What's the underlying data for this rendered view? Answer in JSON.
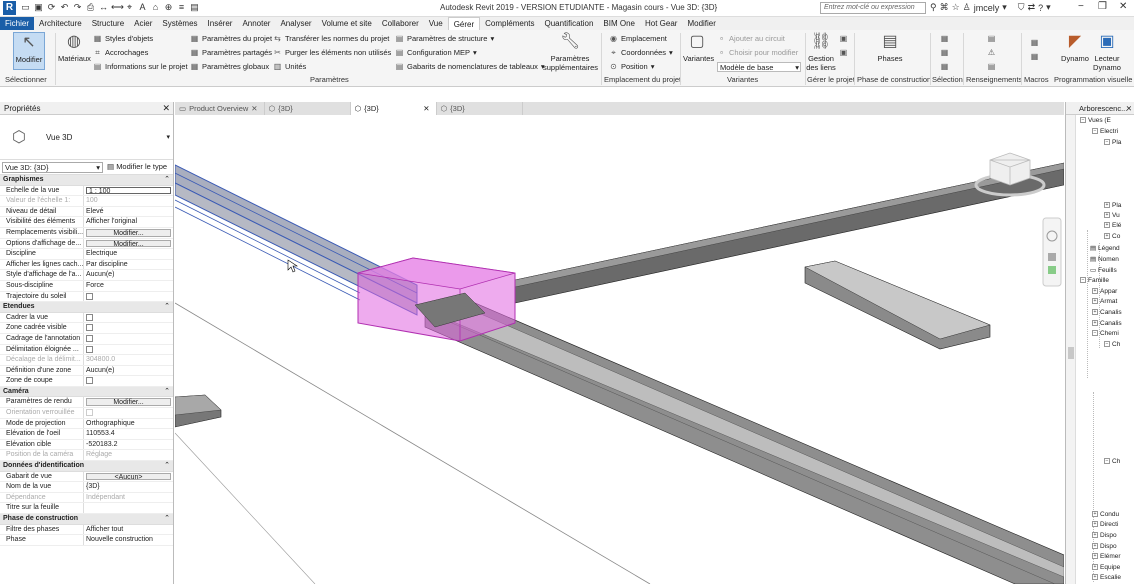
{
  "app": {
    "logo": "R",
    "window_title": "Autodesk Revit 2019 - VERSION ETUDIANTE - Magasin cours - Vue 3D: {3D}",
    "search_placeholder": "Entrez mot-clé ou expression",
    "user": "jmcely"
  },
  "menu": {
    "items": [
      "Fichier",
      "Architecture",
      "Structure",
      "Acier",
      "Systèmes",
      "Insérer",
      "Annoter",
      "Analyser",
      "Volume et site",
      "Collaborer",
      "Vue",
      "Gérer",
      "Compléments",
      "Quantification",
      "BIM One",
      "Hot Gear",
      "Modifier"
    ],
    "active": "Gérer"
  },
  "ribbon": {
    "modifier": "Modifier",
    "materiaux": "Matériaux",
    "styles_objets": "Styles d'objets",
    "accrochages": "Accrochages",
    "infos_projet": "Informations sur le projet",
    "params_projet": "Paramètres du projet",
    "params_partages": "Paramètres partagés",
    "params_globaux": "Paramètres globaux",
    "transferer": "Transférer les normes du projet",
    "purger": "Purger les éléments non utilisés",
    "unites": "Unités",
    "params_structure": "Paramètres de structure",
    "config_mep": "Configuration MEP",
    "gabarits_nomenclatures": "Gabarits de nomenclatures de tableaux",
    "params_supp_1": "Paramètres",
    "params_supp_2": "supplémentaires",
    "emplacement": "Emplacement",
    "coordonnees": "Coordonnées",
    "position": "Position",
    "variantes": "Variantes",
    "ajouter_circuit": "Ajouter au circuit",
    "choisir_modifier": "Choisir pour modifier",
    "modele_base": "Modèle de base",
    "gestion_liens_1": "Gestion",
    "gestion_liens_2": "des liens",
    "phases": "Phases",
    "dynamo": "Dynamo",
    "lecteur_1": "Lecteur",
    "lecteur_2": "Dynamo",
    "panels": {
      "selectionner": "Sélectionner",
      "parametres": "Paramètres",
      "emplacement_projet": "Emplacement du projet",
      "variantes": "Variantes",
      "gerer_projet": "Gérer le projet",
      "phase_construction": "Phase de construction",
      "selection": "Sélection",
      "renseignements": "Renseignements",
      "macros": "Macros",
      "prog_visuelle": "Programmation visuelle"
    }
  },
  "properties": {
    "title": "Propriétés",
    "type_name": "Vue 3D",
    "selector": "Vue 3D: {3D}",
    "edit_type": "Modifier le type",
    "groups": {
      "graphismes": "Graphismes",
      "etendues": "Etendues",
      "camera": "Caméra",
      "donnees": "Données d'identification",
      "phase": "Phase de construction"
    },
    "rows": {
      "echelle_k": "Echelle de la vue",
      "echelle_v": "1 : 100",
      "valeur_k": "Valeur de l'échelle    1:",
      "valeur_v": "100",
      "niveau_k": "Niveau de détail",
      "niveau_v": "Elevé",
      "visib_k": "Visibilité des éléments",
      "visib_v": "Afficher l'original",
      "rempl_k": "Remplacements visibili...",
      "rempl_v": "Modifier...",
      "options_k": "Options d'affichage de...",
      "options_v": "Modifier...",
      "discipline_k": "Discipline",
      "discipline_v": "Electrique",
      "lignes_k": "Afficher les lignes cach...",
      "lignes_v": "Par discipline",
      "style_k": "Style d'affichage de l'a...",
      "style_v": "Aucun(e)",
      "sousdisc_k": "Sous-discipline",
      "sousdisc_v": "Force",
      "trajectoire_k": "Trajectoire du soleil",
      "cadrer_k": "Cadrer la vue",
      "zonecadree_k": "Zone cadrée visible",
      "cadrage_k": "Cadrage de l'annotation",
      "delim_k": "Délimitation éloignée ...",
      "decalage_k": "Décalage de la délimit...",
      "decalage_v": "304800.0",
      "defzone_k": "Définition d'une zone",
      "defzone_v": "Aucun(e)",
      "coupe_k": "Zone de coupe",
      "rendu_k": "Paramètres de rendu",
      "rendu_v": "Modifier...",
      "orient_k": "Orientation verrouillée",
      "mode_k": "Mode de projection",
      "mode_v": "Orthographique",
      "eloeil_k": "Elévation de l'oeil",
      "eloeil_v": "110553.4",
      "elocible_k": "Elévation cible",
      "elocible_v": "-520183.2",
      "poscam_k": "Position de la caméra",
      "poscam_v": "Réglage",
      "gabarit_k": "Gabarit de vue",
      "gabarit_v": "<Aucun>",
      "nom_k": "Nom de la vue",
      "nom_v": "{3D}",
      "depend_k": "Dépendance",
      "depend_v": "Indépendant",
      "titre_k": "Titre sur la feuille",
      "filtre_k": "Filtre des phases",
      "filtre_v": "Afficher tout",
      "phase_k": "Phase",
      "phase_v": "Nouvelle construction"
    }
  },
  "tabs": [
    "Product Overview",
    "{3D}",
    "{3D}",
    "{3D}"
  ],
  "browser": {
    "title": "Arborescenc...",
    "nodes": {
      "vues": "Vues (E",
      "electric": "Electri",
      "pla1": "Pla",
      "pla2": "Pla",
      "vu": "Vu",
      "ele": "Elé",
      "co": "Co",
      "legendes": "Légend",
      "nomenc": "Nomen",
      "feuilles": "Feuills",
      "familles": "Famille",
      "appar": "Appar",
      "armat": "Armat",
      "canal1": "Canalis",
      "canal2": "Canalis",
      "chemin": "Chemi",
      "ch1": "Ch",
      "ch2": "Ch",
      "condu": "Condu",
      "direct": "Directi",
      "dispo1": "Dispo",
      "dispo2": "Dispo",
      "elem": "Elémer",
      "equip": "Equipe",
      "escal": "Escalie"
    }
  },
  "colors": {
    "file_tab": "#1a5ea8",
    "selection_box": "#e066e0",
    "selected_tray": "#3b5bb5"
  }
}
